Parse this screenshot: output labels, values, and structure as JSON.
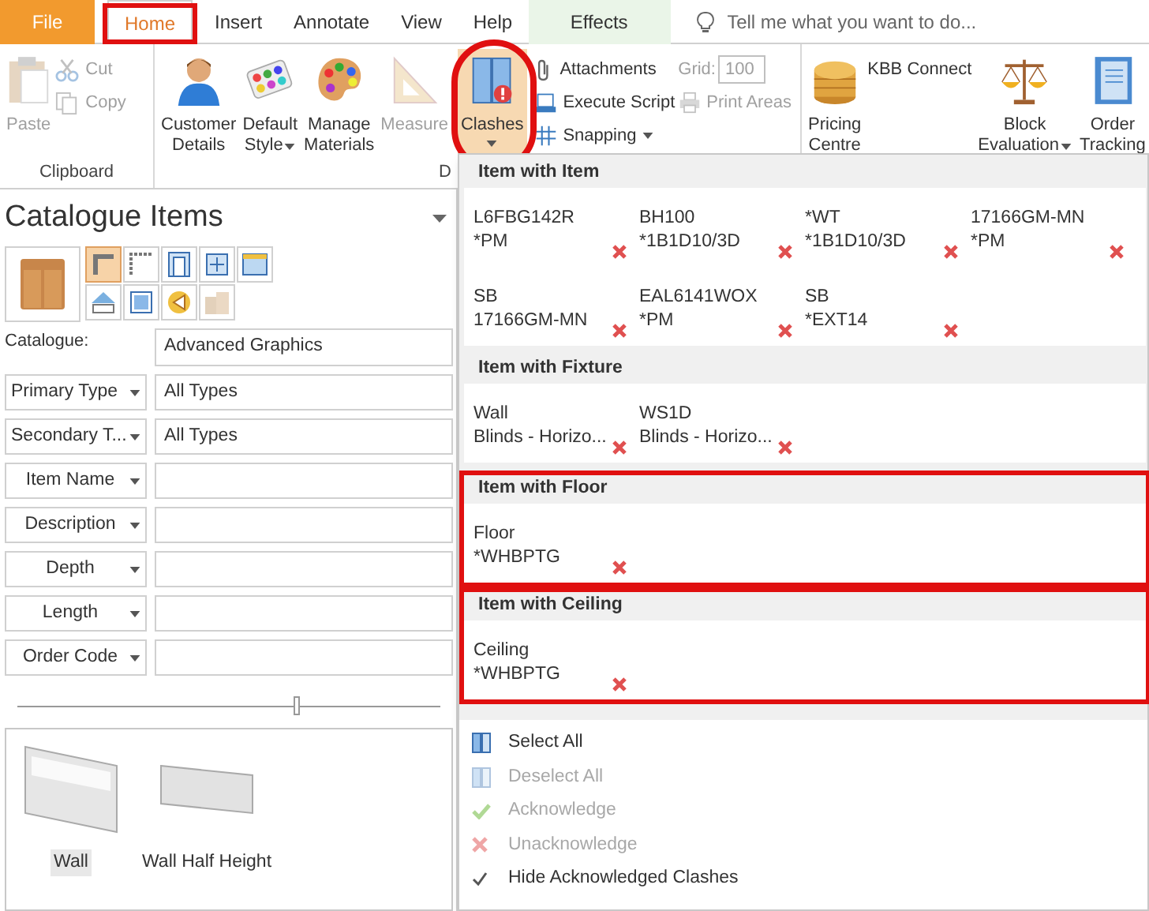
{
  "tabs": [
    {
      "label": "File",
      "kind": "file",
      "selected": false,
      "highlighted": false
    },
    {
      "label": "Home",
      "kind": "tab",
      "selected": true,
      "highlighted": true
    },
    {
      "label": "Insert",
      "kind": "tab",
      "selected": false,
      "highlighted": false
    },
    {
      "label": "Annotate",
      "kind": "tab",
      "selected": false,
      "highlighted": false
    },
    {
      "label": "View",
      "kind": "tab",
      "selected": false,
      "highlighted": false
    },
    {
      "label": "Help",
      "kind": "tab",
      "selected": false,
      "highlighted": false
    },
    {
      "label": "Effects",
      "kind": "contextual",
      "selected": false,
      "highlighted": false
    }
  ],
  "search": {
    "placeholder": "Tell me what you want to do..."
  },
  "ribbon": {
    "groups": [
      {
        "label": "Clipboard",
        "items": [
          {
            "kind": "large",
            "lines": [
              "Paste"
            ],
            "disabled": true,
            "dropdown": false,
            "active": false,
            "highlighted": false
          },
          {
            "kind": "stack",
            "items": [
              {
                "kind": "button",
                "label": "Cut",
                "disabled": true,
                "dropdown": false
              },
              {
                "kind": "button",
                "label": "Copy",
                "disabled": true,
                "dropdown": false
              }
            ]
          }
        ]
      },
      {
        "label": "D",
        "items": [
          {
            "kind": "large",
            "lines": [
              "Customer",
              "Details"
            ],
            "disabled": false,
            "dropdown": false,
            "active": false,
            "highlighted": false
          },
          {
            "kind": "large",
            "lines": [
              "Default",
              "Style"
            ],
            "disabled": false,
            "dropdown": true,
            "active": false,
            "highlighted": false
          },
          {
            "kind": "large",
            "lines": [
              "Manage",
              "Materials"
            ],
            "disabled": false,
            "dropdown": false,
            "active": false,
            "highlighted": false
          },
          {
            "kind": "large",
            "lines": [
              "Measure"
            ],
            "disabled": true,
            "dropdown": false,
            "active": false,
            "highlighted": false
          },
          {
            "kind": "large",
            "lines": [
              "Clashes"
            ],
            "disabled": false,
            "dropdown": true,
            "active": true,
            "highlighted": true
          },
          {
            "kind": "stack",
            "items": [
              {
                "kind": "button",
                "label": "Attachments",
                "disabled": false,
                "dropdown": false
              },
              {
                "kind": "button",
                "label": "Execute Script",
                "disabled": false,
                "dropdown": false
              },
              {
                "kind": "button",
                "label": "Snapping",
                "disabled": false,
                "dropdown": true
              }
            ]
          },
          {
            "kind": "stack",
            "items": [
              {
                "kind": "field",
                "label": "Grid:",
                "value": "100",
                "disabled": true
              },
              {
                "kind": "button",
                "label": "Print Areas",
                "disabled": true,
                "dropdown": false
              }
            ]
          }
        ]
      },
      {
        "items": [
          {
            "kind": "large",
            "lines": [
              "Pricing",
              "Centre"
            ],
            "disabled": false,
            "dropdown": false,
            "active": false,
            "highlighted": false
          },
          {
            "kind": "stack",
            "items": [
              {
                "kind": "button",
                "label": "KBB Connect",
                "disabled": false,
                "dropdown": false
              }
            ]
          },
          {
            "kind": "large",
            "lines": [
              "Block",
              "Evaluation"
            ],
            "disabled": false,
            "dropdown": true,
            "active": false,
            "highlighted": false
          },
          {
            "kind": "large",
            "lines": [
              "Order",
              "Tracking"
            ],
            "disabled": false,
            "dropdown": false,
            "active": false,
            "highlighted": false
          }
        ]
      }
    ]
  },
  "catalogue_panel": {
    "title": "Catalogue Items",
    "type_icons": [
      {
        "kind": "corner",
        "selected": true
      },
      {
        "kind": "corner-dotted",
        "selected": false
      },
      {
        "kind": "door",
        "selected": false
      },
      {
        "kind": "window-grid",
        "selected": false
      },
      {
        "kind": "window-top",
        "selected": false
      },
      {
        "kind": "roof",
        "selected": false
      },
      {
        "kind": "frame",
        "selected": false
      },
      {
        "kind": "speaker",
        "selected": false
      },
      {
        "kind": "boxes",
        "selected": false
      }
    ],
    "catalogue": {
      "label": "Catalogue:",
      "value": "Advanced Graphics"
    },
    "filters": [
      {
        "label": "Primary Type",
        "value": "All Types"
      },
      {
        "label": "Secondary T...",
        "value": "All Types"
      },
      {
        "label": "Item Name"
      },
      {
        "label": "Description"
      },
      {
        "label": "Depth"
      },
      {
        "label": "Length"
      },
      {
        "label": "Order Code"
      }
    ],
    "size_slider": {
      "level": 0.66
    },
    "items": [
      {
        "label": "Wall",
        "kind": "wall",
        "selected": true
      },
      {
        "label": "Wall Half Height",
        "kind": "half-wall",
        "selected": false
      }
    ]
  },
  "clashes_menu": {
    "sections": [
      {
        "title": "Item with Item",
        "highlighted": false,
        "clashes": [
          {
            "first": "L6FBG142R",
            "second": "*PM"
          },
          {
            "first": "BH100",
            "second": "*1B1D10/3D"
          },
          {
            "first": "*WT",
            "second": "*1B1D10/3D"
          },
          {
            "first": "17166GM-MN",
            "second": "*PM"
          },
          {
            "first": "SB",
            "second": "17166GM-MN"
          },
          {
            "first": "EAL6141WOX",
            "second": "*PM"
          },
          {
            "first": "SB",
            "second": "*EXT14"
          }
        ]
      },
      {
        "title": "Item with Fixture",
        "highlighted": false,
        "clashes": [
          {
            "first": "Wall",
            "second": "Blinds  -  Horizo..."
          },
          {
            "first": "WS1D",
            "second": "Blinds  -  Horizo..."
          }
        ]
      },
      {
        "title": "Item with Floor",
        "highlighted": true,
        "clashes": [
          {
            "first": "Floor",
            "second": "*WHBPTG"
          }
        ]
      },
      {
        "title": "Item with Ceiling",
        "highlighted": true,
        "clashes": [
          {
            "first": "Ceiling",
            "second": "*WHBPTG"
          }
        ]
      }
    ],
    "actions": [
      {
        "label": "Select All",
        "kind": "select",
        "disabled": false
      },
      {
        "label": "Deselect All",
        "kind": "select",
        "disabled": true
      },
      {
        "label": "Acknowledge",
        "kind": "tick",
        "disabled": true
      },
      {
        "label": "Unacknowledge",
        "kind": "cross",
        "disabled": true
      },
      {
        "label": "Hide Acknowledged Clashes",
        "kind": "check",
        "disabled": false
      }
    ]
  }
}
